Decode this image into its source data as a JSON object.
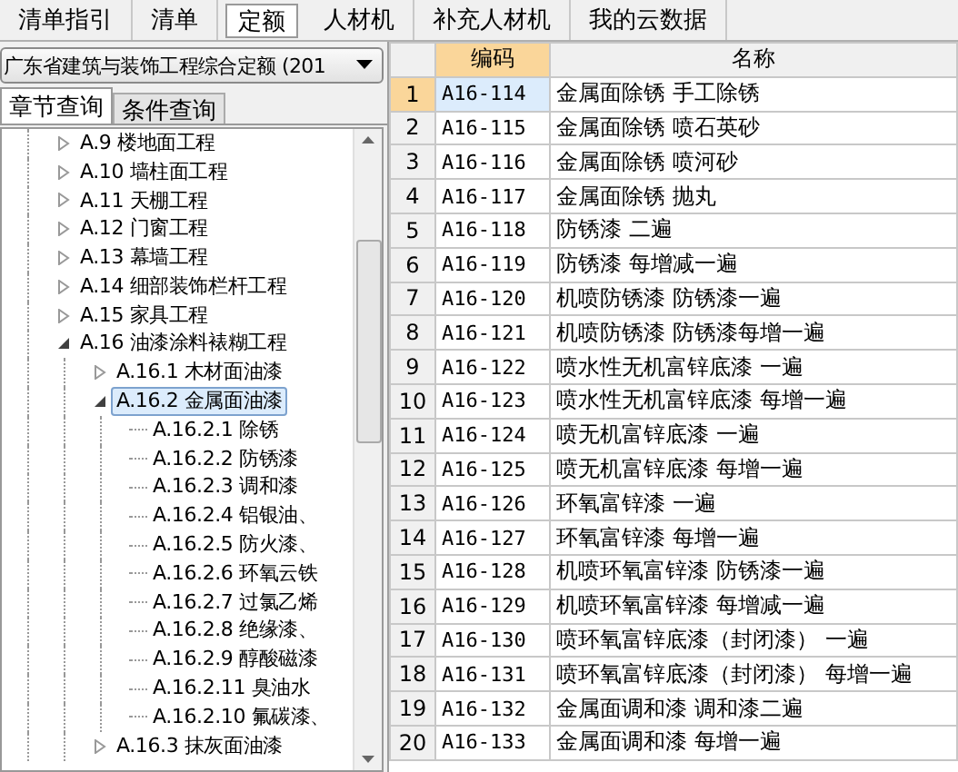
{
  "top_tabs": [
    {
      "label": "清单指引",
      "selected": false
    },
    {
      "label": "清单",
      "selected": false
    },
    {
      "label": "定额",
      "selected": true
    },
    {
      "label": "人材机",
      "selected": false
    },
    {
      "label": "补充人材机",
      "selected": false
    },
    {
      "label": "我的云数据",
      "selected": false
    }
  ],
  "library_dropdown": {
    "value": "广东省建筑与装饰工程综合定额 (201"
  },
  "query_tabs": [
    {
      "label": "章节查询",
      "selected": true
    },
    {
      "label": "条件查询",
      "selected": false
    }
  ],
  "tree": [
    {
      "label": "A.9 楼地面工程",
      "expanded": false,
      "selected": false
    },
    {
      "label": "A.10 墙柱面工程",
      "expanded": false,
      "selected": false
    },
    {
      "label": "A.11 天棚工程",
      "expanded": false,
      "selected": false
    },
    {
      "label": "A.12 门窗工程",
      "expanded": false,
      "selected": false
    },
    {
      "label": "A.13 幕墙工程",
      "expanded": false,
      "selected": false
    },
    {
      "label": "A.14 细部装饰栏杆工程",
      "expanded": false,
      "selected": false
    },
    {
      "label": "A.15 家具工程",
      "expanded": false,
      "selected": false
    },
    {
      "label": "A.16 油漆涂料裱糊工程",
      "expanded": true,
      "selected": false,
      "children": [
        {
          "label": "A.16.1 木材面油漆",
          "expanded": false,
          "selected": false
        },
        {
          "label": "A.16.2 金属面油漆",
          "expanded": true,
          "selected": true,
          "children": [
            {
              "label": "A.16.2.1 除锈",
              "selected": false
            },
            {
              "label": "A.16.2.2 防锈漆",
              "selected": false
            },
            {
              "label": "A.16.2.3 调和漆",
              "selected": false
            },
            {
              "label": "A.16.2.4 铝银油、",
              "selected": false
            },
            {
              "label": "A.16.2.5 防火漆、",
              "selected": false
            },
            {
              "label": "A.16.2.6 环氧云铁",
              "selected": false
            },
            {
              "label": "A.16.2.7 过氯乙烯",
              "selected": false
            },
            {
              "label": "A.16.2.8 绝缘漆、",
              "selected": false
            },
            {
              "label": "A.16.2.9 醇酸磁漆",
              "selected": false
            },
            {
              "label": "A.16.2.11 臭油水",
              "selected": false
            },
            {
              "label": "A.16.2.10 氟碳漆、",
              "selected": false
            }
          ]
        },
        {
          "label": "A.16.3 抹灰面油漆",
          "expanded": false,
          "selected": false
        }
      ]
    }
  ],
  "table": {
    "columns": [
      {
        "label": "编码",
        "selected": true
      },
      {
        "label": "名称",
        "selected": false
      }
    ],
    "rows": [
      {
        "index": "1",
        "code": "A16-114",
        "name": "金属面除锈 手工除锈",
        "selected": true
      },
      {
        "index": "2",
        "code": "A16-115",
        "name": "金属面除锈 喷石英砂",
        "selected": false
      },
      {
        "index": "3",
        "code": "A16-116",
        "name": "金属面除锈 喷河砂",
        "selected": false
      },
      {
        "index": "4",
        "code": "A16-117",
        "name": "金属面除锈 抛丸",
        "selected": false
      },
      {
        "index": "5",
        "code": "A16-118",
        "name": "防锈漆 二遍",
        "selected": false
      },
      {
        "index": "6",
        "code": "A16-119",
        "name": "防锈漆 每增减一遍",
        "selected": false
      },
      {
        "index": "7",
        "code": "A16-120",
        "name": "机喷防锈漆 防锈漆一遍",
        "selected": false
      },
      {
        "index": "8",
        "code": "A16-121",
        "name": "机喷防锈漆 防锈漆每增一遍",
        "selected": false
      },
      {
        "index": "9",
        "code": "A16-122",
        "name": "喷水性无机富锌底漆 一遍",
        "selected": false
      },
      {
        "index": "10",
        "code": "A16-123",
        "name": "喷水性无机富锌底漆 每增一遍",
        "selected": false
      },
      {
        "index": "11",
        "code": "A16-124",
        "name": "喷无机富锌底漆 一遍",
        "selected": false
      },
      {
        "index": "12",
        "code": "A16-125",
        "name": "喷无机富锌底漆 每增一遍",
        "selected": false
      },
      {
        "index": "13",
        "code": "A16-126",
        "name": "环氧富锌漆 一遍",
        "selected": false
      },
      {
        "index": "14",
        "code": "A16-127",
        "name": "环氧富锌漆 每增一遍",
        "selected": false
      },
      {
        "index": "15",
        "code": "A16-128",
        "name": "机喷环氧富锌漆 防锈漆一遍",
        "selected": false
      },
      {
        "index": "16",
        "code": "A16-129",
        "name": "机喷环氧富锌漆 每增减一遍",
        "selected": false
      },
      {
        "index": "17",
        "code": "A16-130",
        "name": "喷环氧富锌底漆（封闭漆） 一遍",
        "selected": false
      },
      {
        "index": "18",
        "code": "A16-131",
        "name": "喷环氧富锌底漆（封闭漆） 每增一遍",
        "selected": false
      },
      {
        "index": "19",
        "code": "A16-132",
        "name": "金属面调和漆 调和漆二遍",
        "selected": false
      },
      {
        "index": "20",
        "code": "A16-133",
        "name": "金属面调和漆 每增一遍",
        "selected": false
      }
    ]
  }
}
